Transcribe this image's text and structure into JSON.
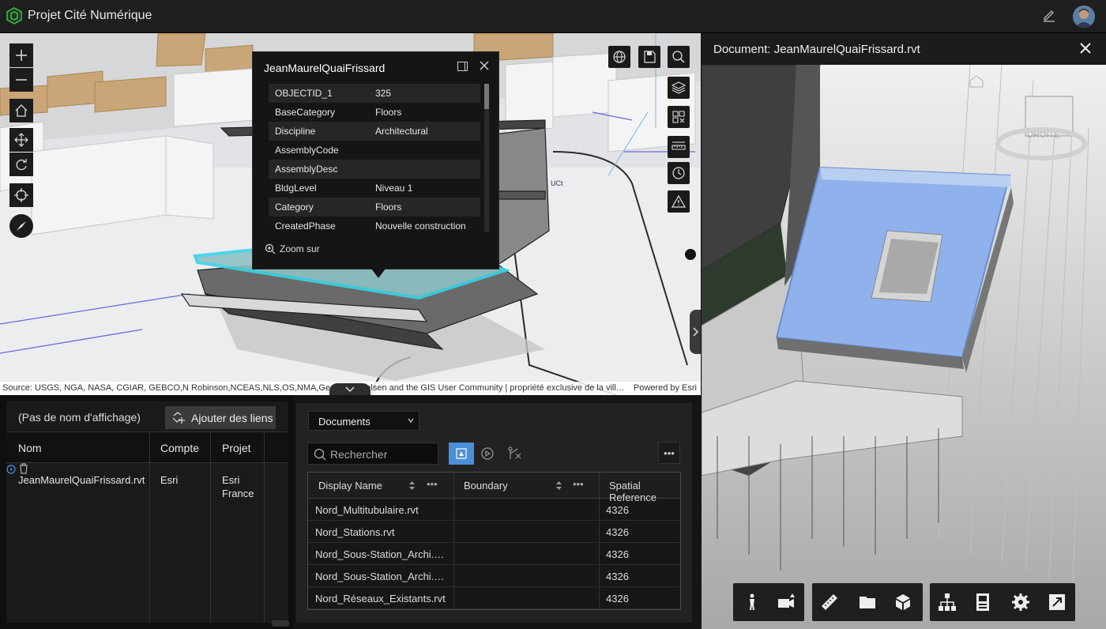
{
  "app": {
    "title": "Projet Cité Numérique"
  },
  "scene": {
    "attribution": "Source: USGS, NGA, NASA, CGIAR, GEBCO,N Robinson,NCEAS,NLS,OS,NMA,Geodatastyrelsen and the GIS User Community | propriété exclusive de la vill…",
    "powered_by": "Powered by Esri",
    "label_uct": "UCt"
  },
  "popup": {
    "title": "JeanMaurelQuaiFrissard",
    "rows": [
      {
        "key": "OBJECTID_1",
        "value": "325"
      },
      {
        "key": "BaseCategory",
        "value": "Floors"
      },
      {
        "key": "Discipline",
        "value": "Architectural"
      },
      {
        "key": "AssemblyCode",
        "value": ""
      },
      {
        "key": "AssemblyDesc",
        "value": ""
      },
      {
        "key": "BldgLevel",
        "value": "Niveau 1"
      },
      {
        "key": "Category",
        "value": "Floors"
      },
      {
        "key": "CreatedPhase",
        "value": "Nouvelle construction"
      }
    ],
    "zoom_label": "Zoom sur"
  },
  "links_panel": {
    "display_name": "(Pas de nom d'affichage)",
    "add_links_label": "Ajouter des liens",
    "columns": [
      "Nom",
      "Compte",
      "Projet"
    ],
    "row": {
      "name": "JeanMaurelQuaiFrissard.rvt",
      "account": "Esri",
      "project_line1": "Esri",
      "project_line2": "France"
    }
  },
  "documents_panel": {
    "select_value": "Documents",
    "search_placeholder": "Rechercher",
    "more_label": "•••",
    "columns": [
      "Display Name",
      "Boundary",
      "Spatial Reference"
    ],
    "rows": [
      {
        "name": "Nord_Multitubulaire.rvt",
        "boundary": "",
        "sr": "4326"
      },
      {
        "name": "Nord_Stations.rvt",
        "boundary": "",
        "sr": "4326"
      },
      {
        "name": "Nord_Sous-Station_Archi.…",
        "boundary": "",
        "sr": "4326"
      },
      {
        "name": "Nord_Sous-Station_Archi.…",
        "boundary": "",
        "sr": "4326"
      },
      {
        "name": "Nord_Réseaux_Existants.rvt",
        "boundary": "",
        "sr": "4326"
      }
    ]
  },
  "document_view": {
    "title": "Document: JeanMaurelQuaiFrissard.rvt",
    "viewcube_label": "DROITE"
  },
  "colors": {
    "accent": "#4a90d9",
    "highlight": "#39d3e6"
  }
}
